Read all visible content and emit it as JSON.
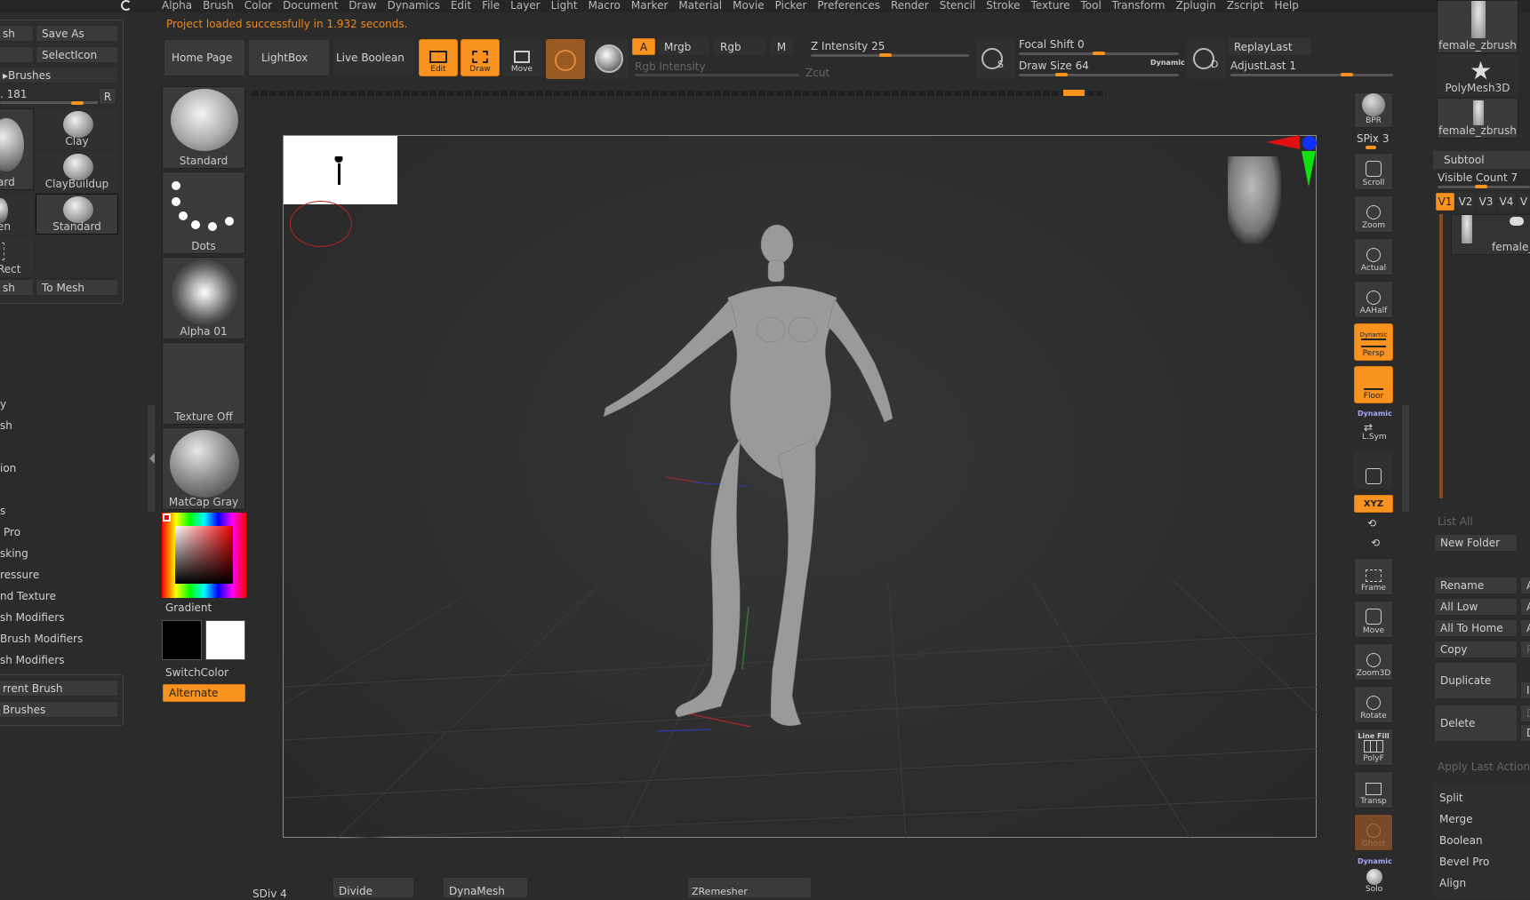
{
  "menu": [
    "Alpha",
    "Brush",
    "Color",
    "Document",
    "Draw",
    "Dynamics",
    "Edit",
    "File",
    "Layer",
    "Light",
    "Macro",
    "Marker",
    "Material",
    "Movie",
    "Picker",
    "Preferences",
    "Render",
    "Stencil",
    "Stroke",
    "Texture",
    "Tool",
    "Transform",
    "Zplugin",
    "Zscript",
    "Help"
  ],
  "status": "Project loaded successfully in 1.932 seconds.",
  "shelf": {
    "home": "Home Page",
    "lightbox": "LightBox",
    "live_boolean": "Live Boolean",
    "edit": "Edit",
    "draw": "Draw",
    "move": "Move",
    "a": "A",
    "mrgb": "Mrgb",
    "rgb": "Rgb",
    "m": "M",
    "rgb_intensity": "Rgb Intensity",
    "z_intensity": "Z Intensity 25",
    "zcut": "Zcut",
    "focal_shift": "Focal Shift 0",
    "draw_size": "Draw Size 64",
    "dynamic": "Dynamic",
    "replay_last": "ReplayLast",
    "adjust_last": "AdjustLast 1",
    "s": "S",
    "d": "D"
  },
  "leftpanel": {
    "sh": "sh",
    "save_as": "Save As",
    "select_icon": "SelectIcon",
    "brushes": "Brushes",
    "val": ". 181",
    "r": "R",
    "clay": "Clay",
    "clay_buildup": "ClayBuildup",
    "standard": "Standard",
    "ard": "ard",
    "en": "en",
    "rect": "Rect",
    "sh2": "sh",
    "to_mesh": "To Mesh",
    "list": [
      "y",
      "sh",
      "ion",
      "s",
      "Pro",
      "sking",
      "ressure",
      "nd Texture",
      "sh Modifiers",
      "Brush Modifiers",
      "sh Modifiers"
    ],
    "current_brush": "rrent Brush",
    "brushes2": "Brushes"
  },
  "palette": {
    "standard": "Standard",
    "dots": "Dots",
    "alpha": "Alpha 01",
    "texture": "Texture Off",
    "matcap": "MatCap Gray",
    "gradient": "Gradient",
    "switch_color": "SwitchColor",
    "alternate": "Alternate"
  },
  "bottom": {
    "sdiv": "SDiv 4",
    "divide": "Divide",
    "dynamesh": "DynaMesh",
    "zremesher": "ZRemesher"
  },
  "rightbar": {
    "bpr": "BPR",
    "spix": "SPix 3",
    "scroll": "Scroll",
    "zoom": "Zoom",
    "actual": "Actual",
    "aahalf": "AAHalf",
    "dynamic": "Dynamic",
    "persp": "Persp",
    "floor": "Floor",
    "dynamic2": "Dynamic",
    "lsym": "L.Sym",
    "xyz": "XYZ",
    "frame": "Frame",
    "move": "Move",
    "zoom3d": "Zoom3D",
    "rotate": "Rotate",
    "linefill": "Line Fill",
    "polyf": "PolyF",
    "transp": "Transp",
    "ghost": "Ghost",
    "dynamic3": "Dynamic",
    "solo": "Solo"
  },
  "tools": {
    "t1": "female_zbrush",
    "t2": "PolyMesh3D",
    "t3": "female_zbrush"
  },
  "subtool": {
    "title": "Subtool",
    "visible": "Visible Count 7",
    "v1": "V1",
    "v2": "V2",
    "v3": "V3",
    "v4": "V4",
    "v5": "V",
    "item": "female_",
    "list_all": "List All",
    "new_folder": "New Folder",
    "rename": "Rename",
    "all_low": "All Low",
    "all_to_home": "All To Home",
    "copy": "Copy",
    "duplicate": "Duplicate",
    "delete": "Delete",
    "apply_last": "Apply Last Action T",
    "split": "Split",
    "merge": "Merge",
    "boolean": "Boolean",
    "bevel_pro": "Bevel Pro",
    "align": "Align",
    "a1": "A",
    "a2": "A",
    "a3": "A",
    "p": "P",
    "i": "I",
    "d1": "D",
    "d2": "D"
  }
}
